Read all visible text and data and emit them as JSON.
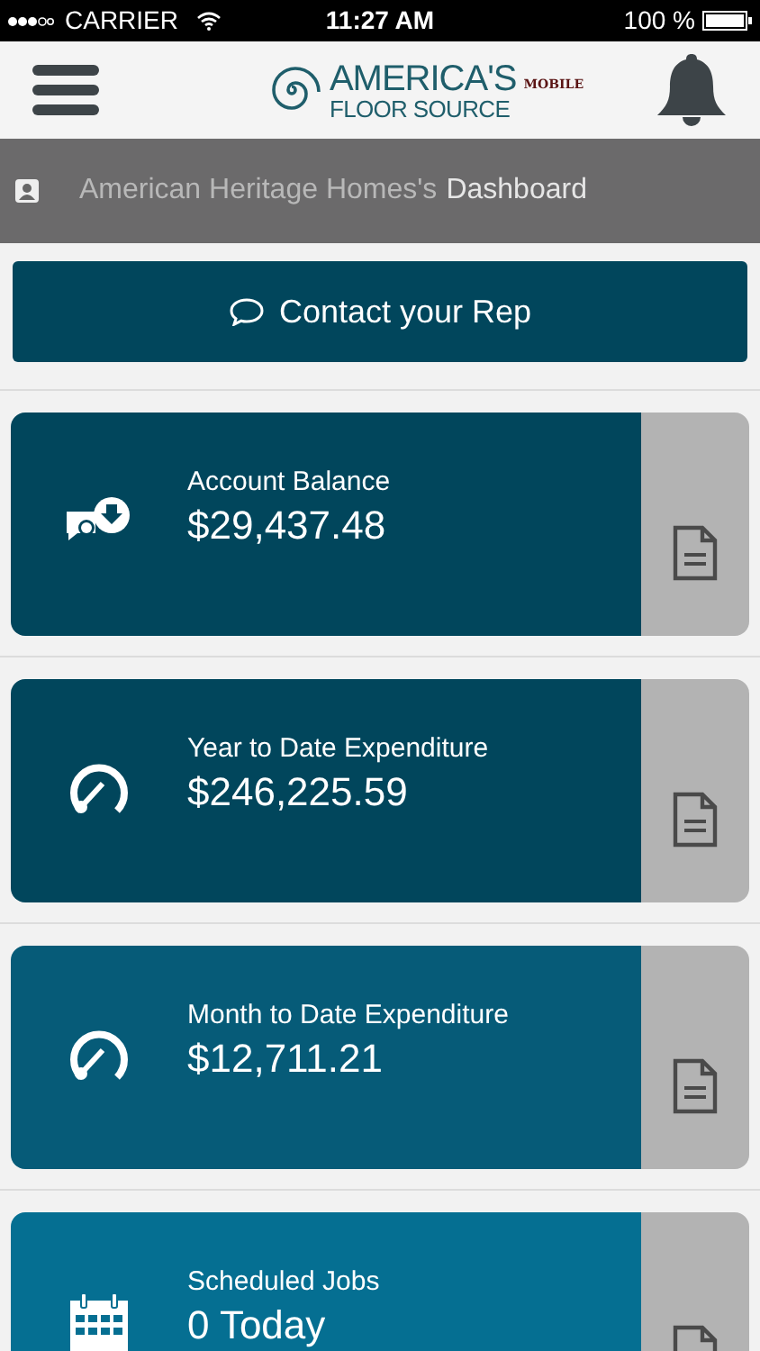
{
  "status_bar": {
    "carrier": "CARRIER",
    "time": "11:27 AM",
    "battery": "100 %"
  },
  "header": {
    "logo_title": "AMERICA'S",
    "logo_subtitle": "FLOOR SOURCE",
    "logo_badge": "MOBILE"
  },
  "dashboard_bar": {
    "account": "American Heritage Homes's",
    "title": "Dashboard"
  },
  "contact_button": {
    "label": "Contact your Rep"
  },
  "cards": [
    {
      "kind": "balance",
      "title": "Account Balance",
      "value": "$29,437.48",
      "color": "#01465c"
    },
    {
      "kind": "gauge",
      "title": "Year to Date Expenditure",
      "value": "$246,225.59",
      "color": "#01465c"
    },
    {
      "kind": "gauge",
      "title": "Month to Date Expenditure",
      "value": "$12,711.21",
      "color": "#065b78"
    },
    {
      "kind": "calendar",
      "title": "Scheduled Jobs",
      "value": "0 Today",
      "color": "#056f92"
    }
  ]
}
